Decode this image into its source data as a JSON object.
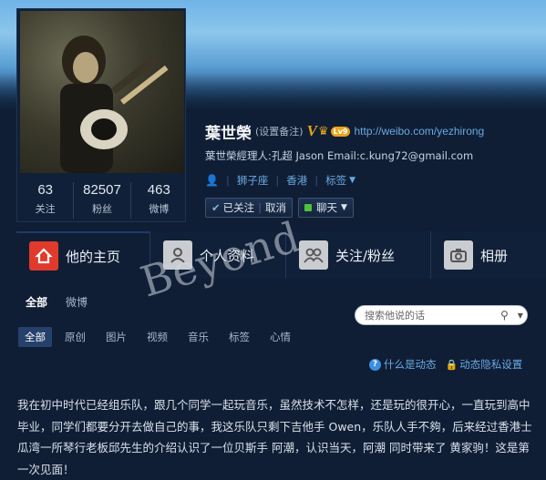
{
  "profile": {
    "name": "葉世榮",
    "remark": "(设置备注)",
    "verified_badge": "V",
    "level_badge": "Lv9",
    "url": "http://weibo.com/yezhirong",
    "description": "葉世榮經理人:孔超 Jason Email:c.kung72@gmail.com",
    "tags": {
      "zodiac": "狮子座",
      "location": "香港",
      "tags_label": "标签"
    },
    "counts": [
      {
        "value": "63",
        "label": "关注"
      },
      {
        "value": "82507",
        "label": "粉丝"
      },
      {
        "value": "463",
        "label": "微博"
      }
    ]
  },
  "actions": {
    "followed_label": "已关注",
    "unfollow_label": "取消",
    "chat_label": "聊天"
  },
  "tabs": [
    {
      "label": "他的主页",
      "icon": "home-icon"
    },
    {
      "label": "个人资料",
      "icon": "profile-icon"
    },
    {
      "label": "关注/粉丝",
      "icon": "follow-icon"
    },
    {
      "label": "相册",
      "icon": "camera-icon"
    }
  ],
  "subnav": {
    "all": "全部",
    "weibo": "微博"
  },
  "search": {
    "placeholder": "搜索他说的话"
  },
  "filters": [
    "全部",
    "原创",
    "图片",
    "视频",
    "音乐",
    "标签",
    "心情"
  ],
  "help": {
    "what_is_feed": "什么是动态",
    "feed_privacy": "动态隐私设置"
  },
  "post": {
    "text": "我在初中时代已经组乐队，跟几个同学一起玩音乐，虽然技术不怎样，还是玩的很开心，一直玩到高中毕业，同学们都要分开去做自己的事，我这乐队只剩下吉他手 Owen，乐队人手不夠，后来经过香港士瓜湾一所琴行老板邱先生的介绍认识了一位贝斯手 阿潮，认识当天，阿潮 同时带来了 黄家驹！这是第一次见面！"
  },
  "watermark": "Beyond"
}
